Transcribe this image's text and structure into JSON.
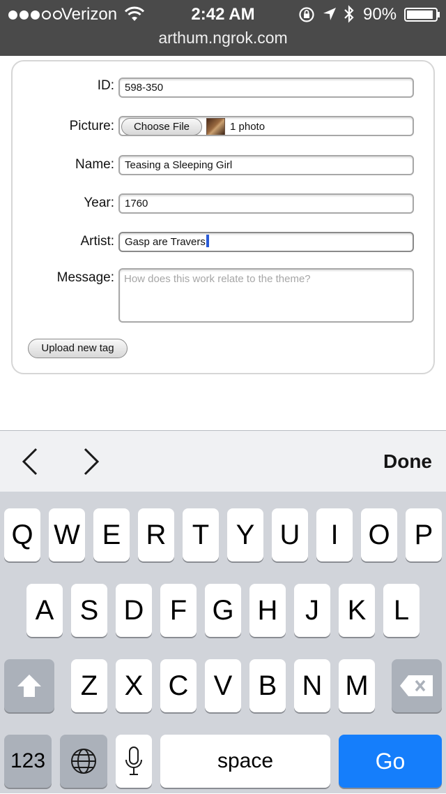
{
  "status_bar": {
    "carrier": "Verizon",
    "signal_bars": 3,
    "signal_total": 5,
    "time": "2:42 AM",
    "battery_percent": "90%",
    "battery_level": 0.9,
    "url": "arthum.ngrok.com",
    "icons": [
      "wifi-icon",
      "rotation-lock-icon",
      "location-arrow-icon",
      "bluetooth-icon",
      "battery-icon"
    ]
  },
  "form": {
    "id_label": "ID:",
    "id_value": "598-350",
    "picture_label": "Picture:",
    "choose_file_label": "Choose File",
    "photo_count": "1 photo",
    "name_label": "Name:",
    "name_value": "Teasing a Sleeping Girl",
    "year_label": "Year:",
    "year_value": "1760",
    "artist_label": "Artist:",
    "artist_value": "Gasp are Travers",
    "message_label": "Message:",
    "message_placeholder": "How does this work relate to the theme?",
    "upload_label": "Upload new tag"
  },
  "accessory_bar": {
    "done_label": "Done",
    "icons": [
      "chevron-left-icon",
      "chevron-right-icon"
    ]
  },
  "keyboard": {
    "row1": [
      "Q",
      "W",
      "E",
      "R",
      "T",
      "Y",
      "U",
      "I",
      "O",
      "P"
    ],
    "row2": [
      "A",
      "S",
      "D",
      "F",
      "G",
      "H",
      "J",
      "K",
      "L"
    ],
    "row3": [
      "Z",
      "X",
      "C",
      "V",
      "B",
      "N",
      "M"
    ],
    "numbers_label": "123",
    "space_label": "space",
    "go_label": "Go",
    "accent_color": "#157efb",
    "icons": [
      "shift-icon",
      "backspace-icon",
      "globe-icon",
      "microphone-icon"
    ]
  }
}
